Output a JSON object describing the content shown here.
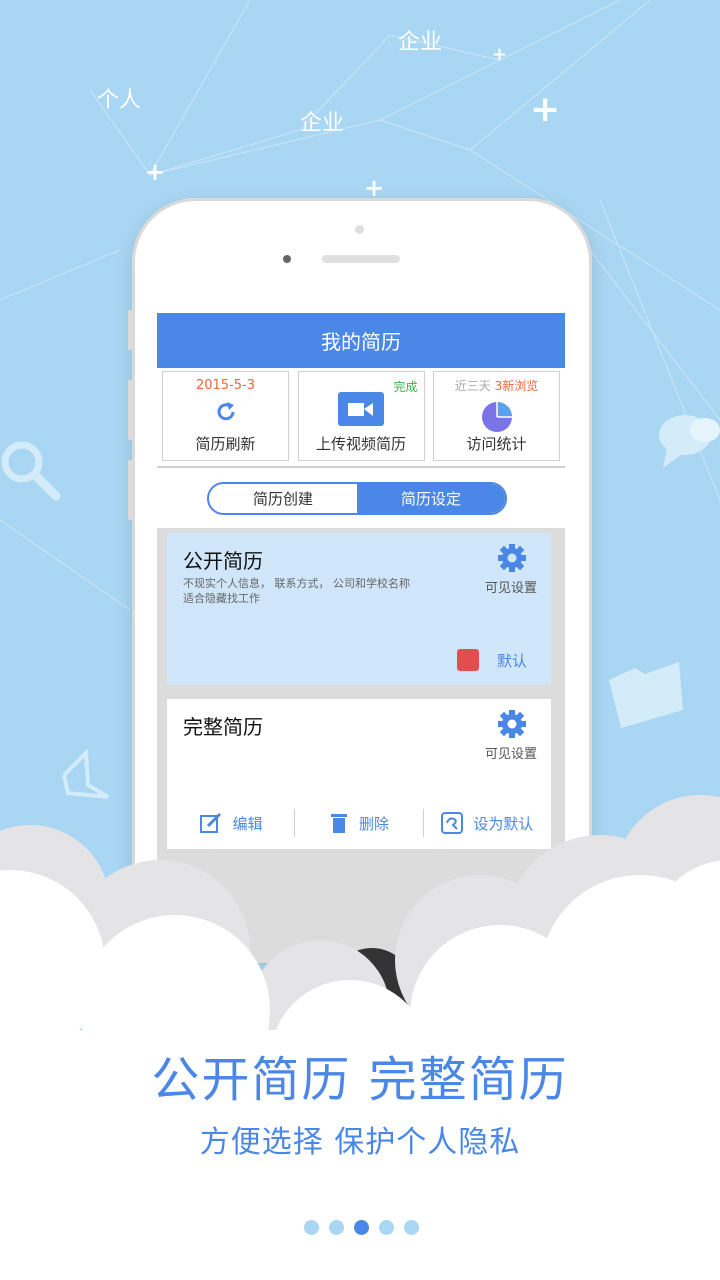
{
  "background": {
    "floating_words": [
      "个人",
      "企业",
      "企业"
    ],
    "color": "#a9d6f2"
  },
  "app": {
    "title": "我的简历",
    "accent": "#4a87e6",
    "quick_actions": [
      {
        "top_text": "2015-5-3",
        "label": "简历刷新",
        "icon": "refresh-icon"
      },
      {
        "badge": "完成",
        "label": "上传视频简历",
        "icon": "video-icon"
      },
      {
        "top_text_prefix": "近三天",
        "top_text_highlight": "3新浏览",
        "label": "访问统计",
        "icon": "pie-chart-icon"
      }
    ],
    "tabs": [
      {
        "label": "简历创建",
        "active": false
      },
      {
        "label": "简历设定",
        "active": true
      }
    ],
    "resumes": [
      {
        "title": "公开简历",
        "description": "不现实个人信息， 联系方式， 公司和学校名称\n适合隐藏找工作",
        "visibility_label": "可见设置",
        "default_label": "默认"
      },
      {
        "title": "完整简历",
        "visibility_label": "可见设置",
        "actions": {
          "edit": "编辑",
          "delete": "删除",
          "set_default": "设为默认"
        }
      }
    ]
  },
  "promo": {
    "headline": "公开简历 完整简历",
    "subline": "方便选择 保护个人隐私"
  },
  "pager": {
    "count": 5,
    "active_index": 2
  }
}
